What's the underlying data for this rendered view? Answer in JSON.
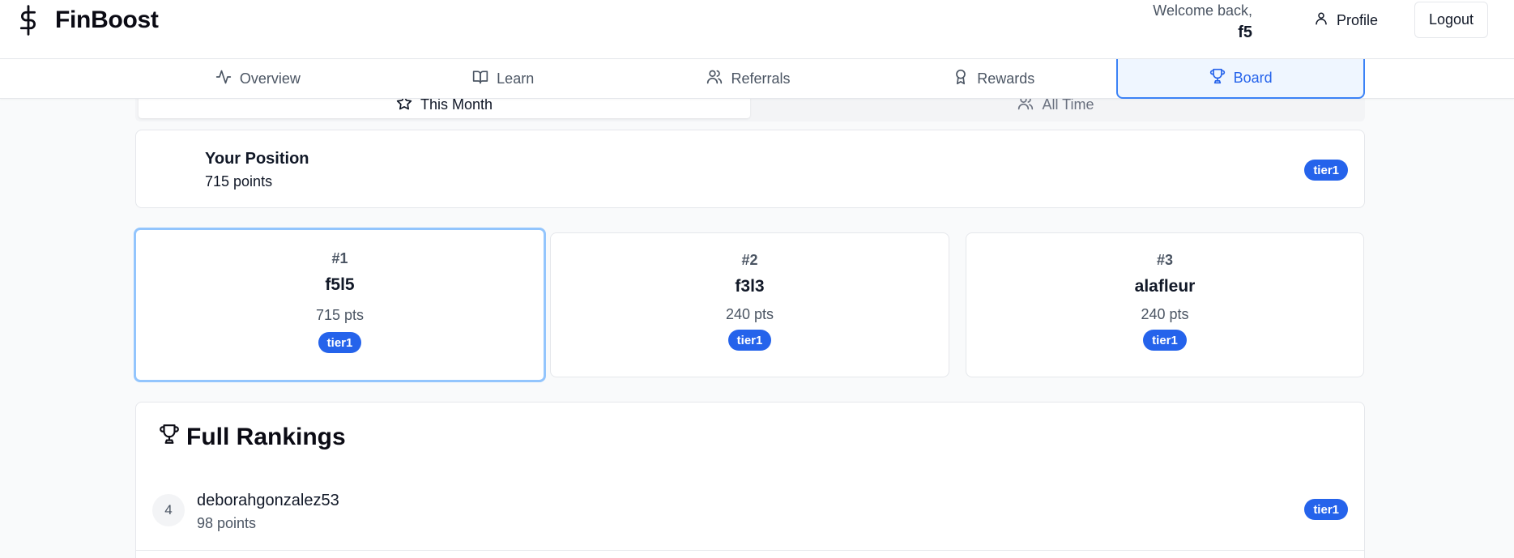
{
  "app": {
    "name": "FinBoost",
    "logo_icon": "dollar-icon"
  },
  "header": {
    "welcome_label": "Welcome back,",
    "username": "f5",
    "profile_label": "Profile",
    "logout_label": "Logout"
  },
  "nav": {
    "tabs": [
      {
        "label": "Overview",
        "icon": "activity-icon",
        "active": false
      },
      {
        "label": "Learn",
        "icon": "book-icon",
        "active": false
      },
      {
        "label": "Referrals",
        "icon": "users-icon",
        "active": false
      },
      {
        "label": "Rewards",
        "icon": "award-icon",
        "active": false
      },
      {
        "label": "Board",
        "icon": "trophy-icon",
        "active": true
      }
    ]
  },
  "period": {
    "tabs": [
      {
        "label": "This Month",
        "icon": "star-icon",
        "active": true
      },
      {
        "label": "All Time",
        "icon": "users-icon",
        "active": false
      }
    ]
  },
  "position": {
    "title": "Your Position",
    "points": "715 points",
    "tier": "tier1"
  },
  "podium": [
    {
      "rank": "#1",
      "name": "f5l5",
      "points": "715 pts",
      "tier": "tier1"
    },
    {
      "rank": "#2",
      "name": "f3l3",
      "points": "240 pts",
      "tier": "tier1"
    },
    {
      "rank": "#3",
      "name": "alafleur",
      "points": "240 pts",
      "tier": "tier1"
    }
  ],
  "rankings": {
    "title": "Full Rankings",
    "rows": [
      {
        "rank": "4",
        "name": "deborahgonzalez53",
        "points": "98 points",
        "tier": "tier1"
      }
    ]
  },
  "colors": {
    "accent": "#2563eb",
    "active_border": "#3b82f6",
    "highlight_border": "#93c5fd"
  }
}
